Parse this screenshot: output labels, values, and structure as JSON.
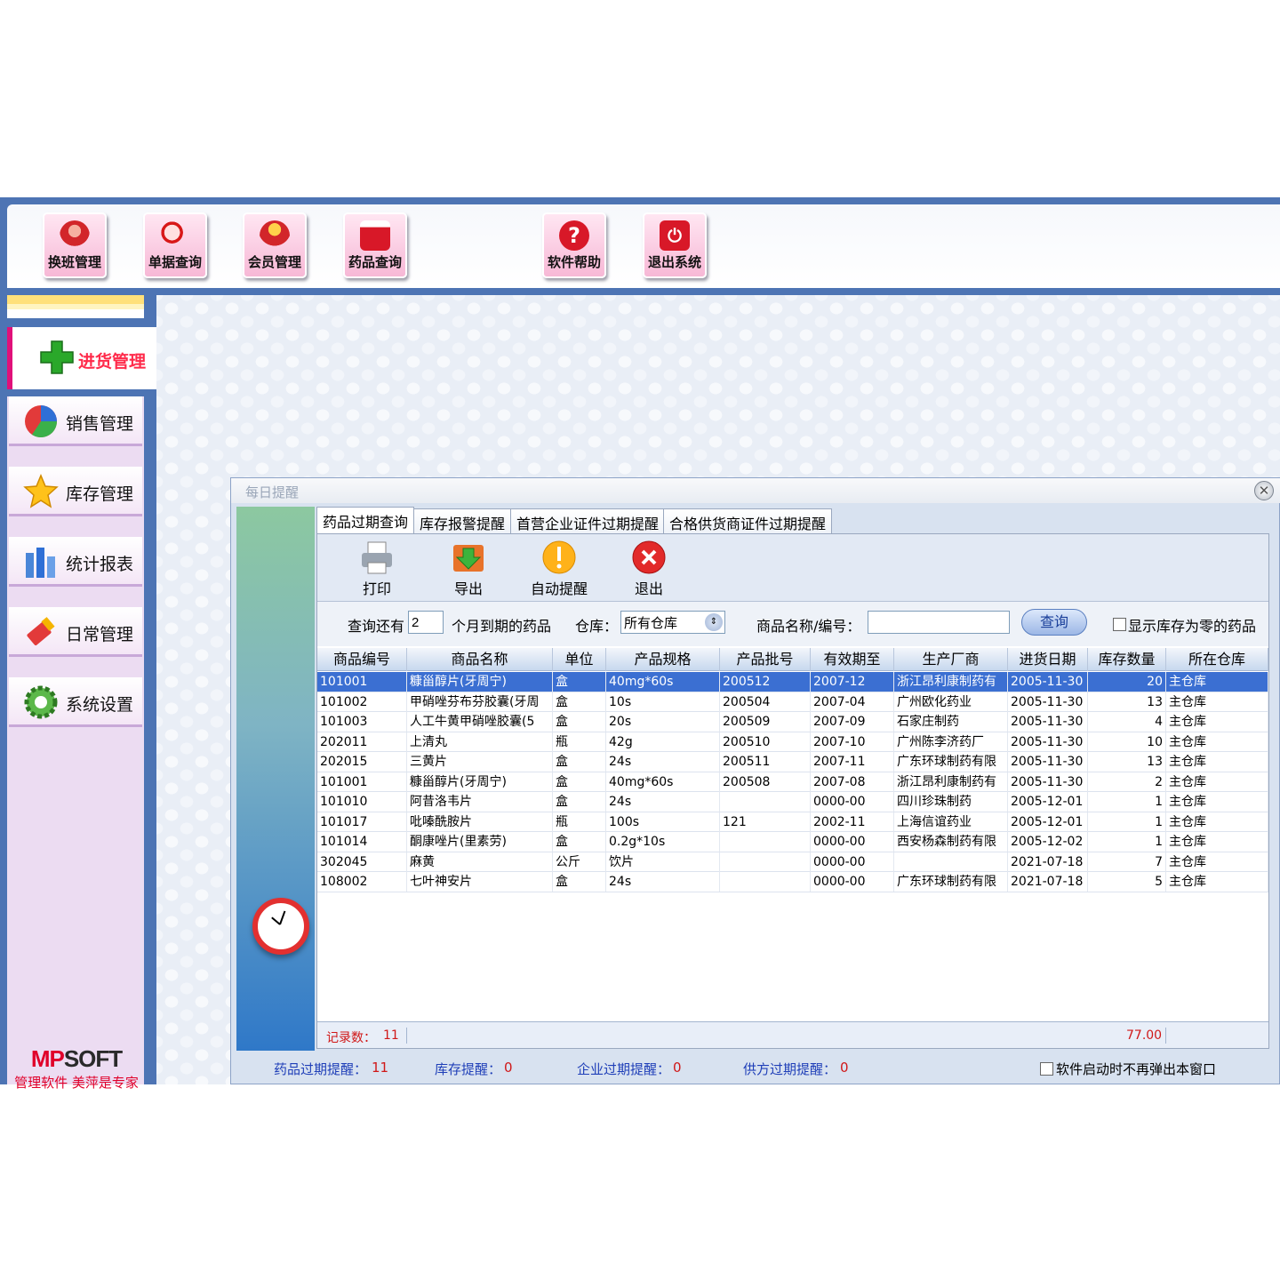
{
  "toolbar": {
    "buttons": [
      {
        "label": "换班管理",
        "icon": "users-icon"
      },
      {
        "label": "单据查询",
        "icon": "search-icon"
      },
      {
        "label": "会员管理",
        "icon": "member-icon"
      },
      {
        "label": "药品查询",
        "icon": "medicine-icon"
      },
      {
        "label": "软件帮助",
        "icon": "help-icon"
      },
      {
        "label": "退出系统",
        "icon": "power-icon"
      }
    ]
  },
  "sidebar": {
    "active": {
      "label": "进货管理",
      "icon": "plus-icon"
    },
    "items": [
      {
        "label": "销售管理",
        "icon": "pie-chart-icon"
      },
      {
        "label": "库存管理",
        "icon": "star-icon"
      },
      {
        "label": "统计报表",
        "icon": "bar-chart-icon"
      },
      {
        "label": "日常管理",
        "icon": "brush-icon"
      },
      {
        "label": "系统设置",
        "icon": "gear-icon"
      }
    ],
    "brand_logo_red": "MP",
    "brand_logo_dark": "SOFT",
    "brand_slogan": "管理软件  美萍是专家"
  },
  "dialog": {
    "title": "每日提醒",
    "tabs": [
      "药品过期查询",
      "库存报警提醒",
      "首营企业证件过期提醒",
      "合格供货商证件过期提醒"
    ],
    "tools": [
      {
        "label": "打印",
        "icon": "printer-icon"
      },
      {
        "label": "导出",
        "icon": "export-icon"
      },
      {
        "label": "自动提醒",
        "icon": "alert-icon"
      },
      {
        "label": "退出",
        "icon": "exit-icon"
      }
    ],
    "filter": {
      "prefix": "查询还有",
      "months_value": "2",
      "suffix": "个月到期的药品",
      "warehouse_label": "仓库：",
      "warehouse_value": "所有仓库",
      "name_label": "商品名称/编号：",
      "name_value": "",
      "query_button": "查询",
      "show_zero_label": "显示库存为零的药品"
    },
    "columns": [
      "商品编号",
      "商品名称",
      "单位",
      "产品规格",
      "产品批号",
      "有效期至",
      "生产厂商",
      "进货日期",
      "库存数量",
      "所在仓库"
    ],
    "rows": [
      [
        "101001",
        "糠甾醇片(牙周宁)",
        "盒",
        "40mg*60s",
        "200512",
        "2007-12",
        "浙江昂利康制药有",
        "2005-11-30",
        "20",
        "主仓库"
      ],
      [
        "101002",
        "甲硝唑芬布芬胶囊(牙周",
        "盒",
        "10s",
        "200504",
        "2007-04",
        "广州欧化药业",
        "2005-11-30",
        "13",
        "主仓库"
      ],
      [
        "101003",
        "人工牛黄甲硝唑胶囊(5",
        "盒",
        "20s",
        "200509",
        "2007-09",
        "石家庄制药",
        "2005-11-30",
        "4",
        "主仓库"
      ],
      [
        "202011",
        "上清丸",
        "瓶",
        "42g",
        "200510",
        "2007-10",
        "广州陈李济药厂",
        "2005-11-30",
        "10",
        "主仓库"
      ],
      [
        "202015",
        "三黄片",
        "盒",
        "24s",
        "200511",
        "2007-11",
        "广东环球制药有限",
        "2005-11-30",
        "13",
        "主仓库"
      ],
      [
        "101001",
        "糠甾醇片(牙周宁)",
        "盒",
        "40mg*60s",
        "200508",
        "2007-08",
        "浙江昂利康制药有",
        "2005-11-30",
        "2",
        "主仓库"
      ],
      [
        "101010",
        "阿昔洛韦片",
        "盒",
        "24s",
        "",
        "0000-00",
        "四川珍珠制药",
        "2005-12-01",
        "1",
        "主仓库"
      ],
      [
        "101017",
        "吡嗪酰胺片",
        "瓶",
        "100s",
        "121",
        "2002-11",
        "上海信谊药业",
        "2005-12-01",
        "1",
        "主仓库"
      ],
      [
        "101014",
        "酮康唑片(里素劳)",
        "盒",
        "0.2g*10s",
        "",
        "0000-00",
        "西安杨森制药有限",
        "2005-12-02",
        "1",
        "主仓库"
      ],
      [
        "302045",
        "麻黄",
        "公斤",
        "饮片",
        "",
        "0000-00",
        "",
        "2021-07-18",
        "7",
        "主仓库"
      ],
      [
        "108002",
        "七叶神安片",
        "盒",
        "24s",
        "",
        "0000-00",
        "广东环球制药有限",
        "2021-07-18",
        "5",
        "主仓库"
      ]
    ],
    "footer": {
      "count_label": "记录数：",
      "count_value": "11",
      "total": "77.00"
    },
    "status": {
      "expire_label": "药品过期提醒：",
      "expire_value": "11",
      "stock_label": "库存提醒：",
      "stock_value": "0",
      "company_label": "企业过期提醒：",
      "company_value": "0",
      "supplier_label": "供方过期提醒：",
      "supplier_value": "0",
      "no_popup_label": "软件启动时不再弹出本窗口"
    },
    "close_glyph": "✕"
  },
  "colors": {
    "accent_blue": "#4d74b4",
    "selected_row": "#3b6fd2",
    "brand_red": "#e0002a",
    "active_menu_pink": "#e0107a"
  }
}
